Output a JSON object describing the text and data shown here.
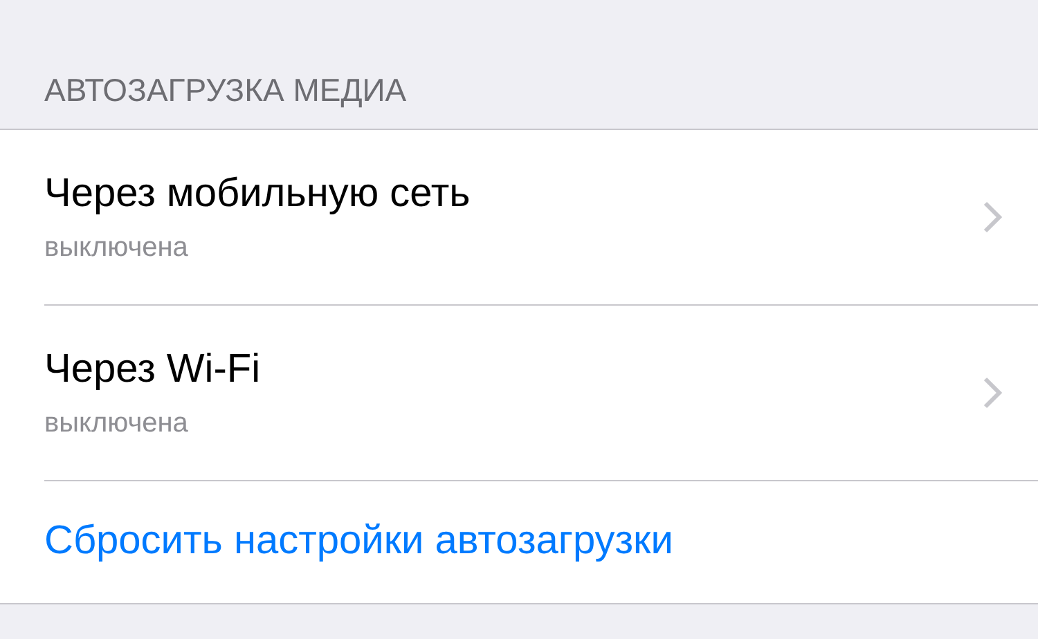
{
  "section_header": "АВТОЗАГРУЗКА МЕДИА",
  "items": [
    {
      "title": "Через мобильную сеть",
      "subtitle": "выключена"
    },
    {
      "title": "Через Wi-Fi",
      "subtitle": "выключена"
    }
  ],
  "reset_link": "Сбросить настройки автозагрузки"
}
